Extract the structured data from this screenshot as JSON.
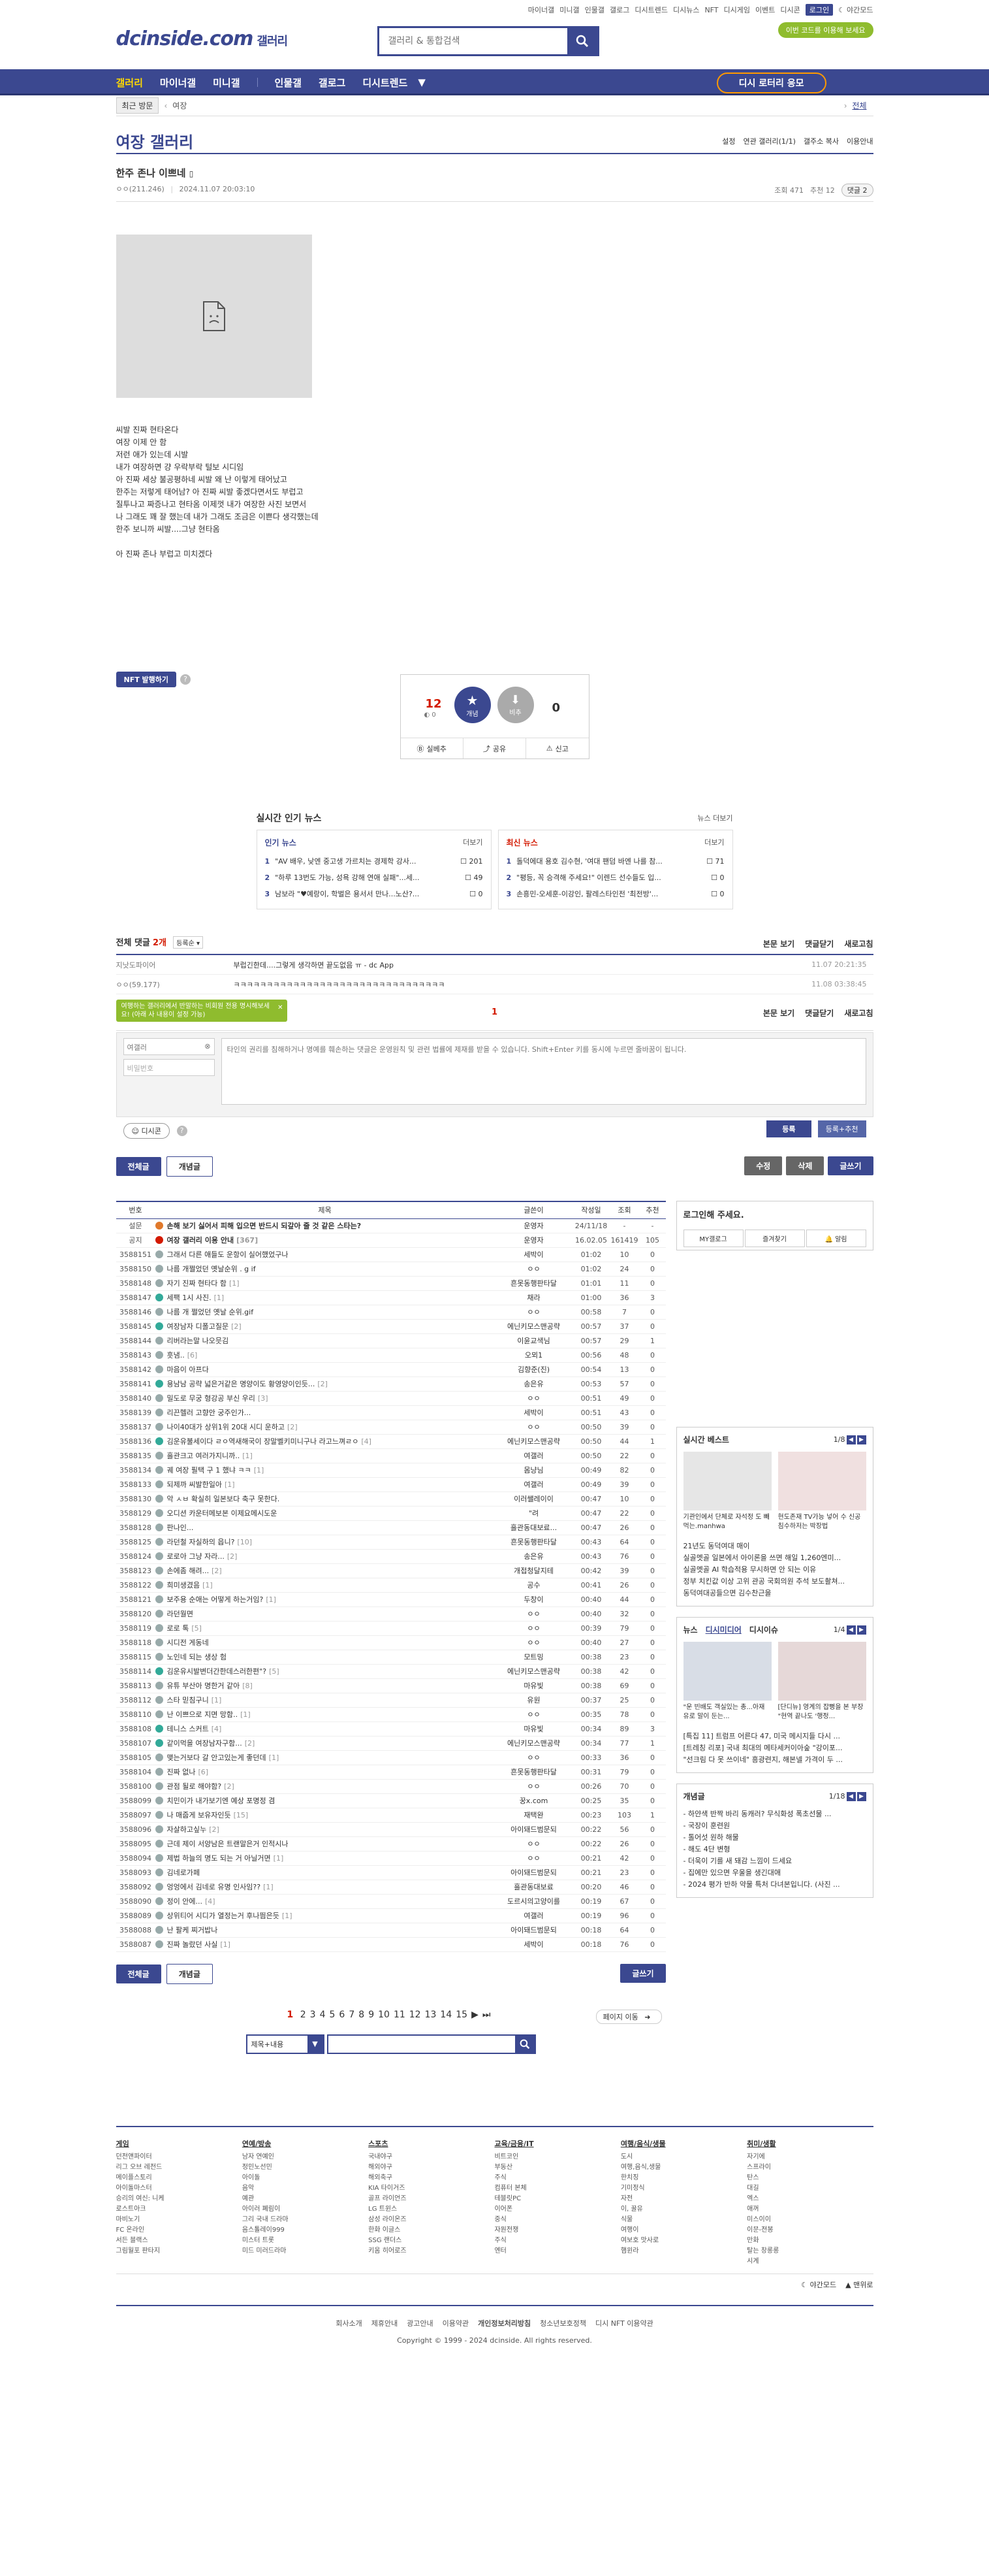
{
  "topbar": {
    "links": [
      "마이너갤",
      "미니갤",
      "인물갤",
      "갤로그",
      "디시트렌드",
      "디시뉴스",
      "NFT",
      "디시게임",
      "이벤트",
      "디시콘"
    ],
    "login": "로그인",
    "dark": "야간모드"
  },
  "header": {
    "logo": "dcinside.com",
    "gallery": "갤러리",
    "search_placeholder": "갤러리 & 통합검색",
    "promo": "이번 코드를 이용해 보세요"
  },
  "nav": {
    "items": [
      "갤러리",
      "마이너갤",
      "미니갤",
      "인물갤",
      "갤로그",
      "디시트렌드"
    ],
    "lotto": "디시 로터리 응모"
  },
  "subnav": {
    "recent": "최근 방문",
    "crumb": "여장",
    "all": "전체"
  },
  "gallery": {
    "title": "여장 갤러리",
    "tools": [
      "설정",
      "연관 갤러리(1/1)",
      "갤주소 복사",
      "이용안내"
    ]
  },
  "post": {
    "title": "한주 존나 이쁘네",
    "author": "ㅇㅇ(211.246)",
    "date": "2024.11.07 20:03:10",
    "views": "조회 471",
    "recs": "추천 12",
    "comments": "댓글 2",
    "body": [
      "씨발 진짜 현타온다",
      "여장 이제 안 함",
      "저런 애가 있는데 시발",
      "내가 여장하면 걍 우락부락 털보 시디임",
      "아 진짜 세상 불공평하네 씨발 왜 난 이렇게 태어났고",
      "한주는 저렇게 태어남? 아 진짜 씨발 좋겠다면서도 부럽고",
      "질투나고 짜증나고 현타옴 이제껏 내가 여장한 사진 보면서",
      "나 그래도 꽤 잘 했는데 내가 그래도 조금은 이쁜다 생각했는데",
      "한주 보니까 씨발....그냥 현타옴",
      "",
      "아 진짜 존나 부럽고 미치겠다"
    ],
    "nft": "NFT 발행하기"
  },
  "recommend": {
    "up": "12",
    "up_sub": "0",
    "up_label": "개념",
    "down": "0",
    "down_label": "비추",
    "actions": [
      "실베추",
      "공유",
      "신고"
    ]
  },
  "news": {
    "title": "실시간 인기 뉴스",
    "more": "뉴스 더보기",
    "popular_label": "인기 뉴스",
    "latest_label": "최신 뉴스",
    "more_small": "더보기",
    "popular": [
      {
        "rank": "1",
        "text": "\"AV 배우, 낮엔 중고생 가르치는 경제학 강사...",
        "count": "201"
      },
      {
        "rank": "2",
        "text": "\"하루 13번도 가능, 성욕 강해 연애 실패\"...세...",
        "count": "49"
      },
      {
        "rank": "3",
        "text": "남보라 \"♥예랑이, 학벌은 용서서 만나...노산?...",
        "count": "0"
      }
    ],
    "latest": [
      {
        "rank": "1",
        "text": "돌덕에대 용호 김수현, '여대 팬덤 바엔 나를 참...",
        "count": "71"
      },
      {
        "rank": "2",
        "text": "\"평등, 꼭 승격해 주세요!\" 이렌드 선수들도 입...",
        "count": "0"
      },
      {
        "rank": "3",
        "text": "손흥민-오세훈-이강인, 팔레스타인전 '최전방'...",
        "count": "0"
      }
    ]
  },
  "comments": {
    "total_label": "전체 댓글",
    "total": "2개",
    "sort": "등록순",
    "right": [
      "본문 보기",
      "댓글닫기",
      "새로고침"
    ],
    "items": [
      {
        "nick": "지낫도파이어",
        "text": "부럽긴한데....그렇게 생각하면 끝도없음 ㅠ - dc App",
        "date": "11.07 20:21:35"
      },
      {
        "nick": "ㅇㅇ(59.177)",
        "text": "ㅋㅋㅋㅋㅋㅋㅋㅋㅋㅋㅋㅋㅋㅋㅋㅋㅋㅋㅋㅋㅋㅋㅋㅋㅋㅋㅋㅋㅋㅋㅋㅋ",
        "date": "11.08 03:38:45"
      }
    ],
    "page": "1",
    "tip": "여행하는 갤러리에서 반말하는 비회원 전용 명시해보세요! (아래 사 내용이 설정 가능)",
    "nick_default": "여갤러",
    "pw_placeholder": "비밀번호",
    "textarea_placeholder": "타인의 권리를 침해하거나 명예를 훼손하는 댓글은 운영원칙 및 관련 법률에 제재를 받을 수 있습니다. Shift+Enter 키를 동시에 누르면 줄바꿈이 됩니다.",
    "dccon": "디시콘",
    "submit": "등록",
    "submit_rec": "등록+추천"
  },
  "listbtns": {
    "all": "전체글",
    "concept": "개념글",
    "edit": "수정",
    "delete": "삭제",
    "write": "글쓰기"
  },
  "list": {
    "headers": [
      "번호",
      "제목",
      "글쓴이",
      "작성일",
      "조회",
      "추천"
    ],
    "rows": [
      {
        "no": "설문",
        "title": "손해 보기 싫어서 피해 입으면 반드시 되갚아 줄 것 같은 스타는?",
        "writer": "운영자",
        "date": "24/11/18",
        "views": "-",
        "recs": "-",
        "notice": true,
        "icon": "#e0792b"
      },
      {
        "no": "공지",
        "title": "여장 갤러리 이용 안내",
        "rc": "[367]",
        "writer": "운영자",
        "date": "16.02.05",
        "views": "161419",
        "recs": "105",
        "notice": true,
        "icon": "#d31900"
      },
      {
        "no": "3588151",
        "title": "그래서 다른 애들도 운항이 실어했었구나",
        "writer": "세박이",
        "date": "01:02",
        "views": "10",
        "recs": "0",
        "icon": "#9aa"
      },
      {
        "no": "3588150",
        "title": "나름 개쩔었던 옛날순위 . g if",
        "writer": "ㅇㅇ",
        "date": "01:02",
        "views": "24",
        "recs": "0",
        "icon": "#9aa"
      },
      {
        "no": "3588148",
        "title": "자기 진짜 현타다 함",
        "rc": "[1]",
        "writer": "흔못동행판타달",
        "date": "01:01",
        "views": "11",
        "recs": "0",
        "icon": "#9aa"
      },
      {
        "no": "3588147",
        "title": "세팩 1시 사진.",
        "rc": "[1]",
        "writer": "채라",
        "date": "01:00",
        "views": "36",
        "recs": "3",
        "icon": "#3a9"
      },
      {
        "no": "3588146",
        "title": "나름 개 쩔었던 옛날 순위.gif",
        "writer": "ㅇㅇ",
        "date": "00:58",
        "views": "7",
        "recs": "0",
        "icon": "#9aa"
      },
      {
        "no": "3588145",
        "title": "여장남자 디폴고질문",
        "rc": "[2]",
        "writer": "에닌키모스맨공략",
        "date": "00:57",
        "views": "37",
        "recs": "0",
        "icon": "#3a9"
      },
      {
        "no": "3588144",
        "title": "리버라는말 나오믓김",
        "writer": "이윤교색님",
        "date": "00:57",
        "views": "29",
        "recs": "1",
        "icon": "#9aa"
      },
      {
        "no": "3588143",
        "title": "흣냄..",
        "rc": "[6]",
        "writer": "오뫼1",
        "date": "00:56",
        "views": "48",
        "recs": "0",
        "icon": "#9aa"
      },
      {
        "no": "3588142",
        "title": "마음이 아프다",
        "writer": "김향준(진)",
        "date": "00:54",
        "views": "13",
        "recs": "0",
        "icon": "#9aa"
      },
      {
        "no": "3588141",
        "title": "용남남 공략 넓은거같은 명양이도 황영양이인듯...",
        "rc": "[2]",
        "writer": "송은유",
        "date": "00:53",
        "views": "57",
        "recs": "0",
        "icon": "#3a9"
      },
      {
        "no": "3588140",
        "title": "밀도로 무궁 형강공 부신 우리",
        "rc": "[3]",
        "writer": "ㅇㅇ",
        "date": "00:51",
        "views": "49",
        "recs": "0",
        "icon": "#9aa"
      },
      {
        "no": "3588139",
        "title": "리끈헬러 고향안 궁주인가...",
        "writer": "세박이",
        "date": "00:51",
        "views": "43",
        "recs": "0",
        "icon": "#9aa"
      },
      {
        "no": "3588137",
        "title": "나이40대가 상위1위 20대 시디 운하고",
        "rc": "[2]",
        "writer": "ㅇㅇ",
        "date": "00:50",
        "views": "39",
        "recs": "0",
        "icon": "#9aa"
      },
      {
        "no": "3588136",
        "title": "김운유불세이다 ㄹㅇ역새해국이 장말벨키미니구나 라고느껴ㄹㅇ",
        "rc": "[4]",
        "writer": "에닌키모스맨공략",
        "date": "00:50",
        "views": "44",
        "recs": "1",
        "icon": "#3a9"
      },
      {
        "no": "3588135",
        "title": "흘관크고 여러가지니까..",
        "rc": "[1]",
        "writer": "여갤러",
        "date": "00:50",
        "views": "22",
        "recs": "0",
        "icon": "#9aa"
      },
      {
        "no": "3588134",
        "title": "궤 여장 필택 구 1 했냐 ㅋㅋ",
        "rc": "[1]",
        "writer": "몸냥님",
        "date": "00:49",
        "views": "82",
        "recs": "0",
        "icon": "#9aa"
      },
      {
        "no": "3588133",
        "title": "되제까 씨발한일아",
        "rc": "[1]",
        "writer": "여갤러",
        "date": "00:49",
        "views": "39",
        "recs": "0",
        "icon": "#9aa"
      },
      {
        "no": "3588130",
        "title": "악 ㅅㅂ 확실히 일본보다 축구 못한다.",
        "writer": "이러쌜레이이",
        "date": "00:47",
        "views": "10",
        "recs": "0",
        "icon": "#9aa"
      },
      {
        "no": "3588129",
        "title": "오디션 카운터메보본 이제요메시도운",
        "writer": "\"려",
        "date": "00:47",
        "views": "22",
        "recs": "0",
        "icon": "#9aa"
      },
      {
        "no": "3588128",
        "title": "판나인...",
        "writer": "흘관동대보료...",
        "date": "00:47",
        "views": "26",
        "recs": "0",
        "icon": "#9aa"
      },
      {
        "no": "3588125",
        "title": "라던철 자실하의 읍니?",
        "rc": "[10]",
        "writer": "흔못동행판타달",
        "date": "00:43",
        "views": "64",
        "recs": "0",
        "icon": "#9aa"
      },
      {
        "no": "3588124",
        "title": "로로아 그냥 자라...",
        "rc": "[2]",
        "writer": "송은유",
        "date": "00:43",
        "views": "76",
        "recs": "0",
        "icon": "#9aa"
      },
      {
        "no": "3588123",
        "title": "손에좀 해려...",
        "rc": "[2]",
        "writer": "개접청달지테",
        "date": "00:42",
        "views": "39",
        "recs": "0",
        "icon": "#9aa"
      },
      {
        "no": "3588122",
        "title": "희미생겼음",
        "rc": "[1]",
        "writer": "공수",
        "date": "00:41",
        "views": "26",
        "recs": "0",
        "icon": "#9aa"
      },
      {
        "no": "3588121",
        "title": "보주용 순애는 어떻게 하는거임?",
        "rc": "[1]",
        "writer": "두창이",
        "date": "00:40",
        "views": "44",
        "recs": "0",
        "icon": "#9aa"
      },
      {
        "no": "3588120",
        "title": "라던월면",
        "writer": "ㅇㅇ",
        "date": "00:40",
        "views": "32",
        "recs": "0",
        "icon": "#9aa"
      },
      {
        "no": "3588119",
        "title": "로로 톡",
        "rc": "[5]",
        "writer": "ㅇㅇ",
        "date": "00:39",
        "views": "79",
        "recs": "0",
        "icon": "#9aa"
      },
      {
        "no": "3588118",
        "title": "시디전 게동네",
        "writer": "ㅇㅇ",
        "date": "00:40",
        "views": "27",
        "recs": "0",
        "icon": "#9aa"
      },
      {
        "no": "3588115",
        "title": "노인네 되는 생상 험",
        "writer": "모트밍",
        "date": "00:38",
        "views": "23",
        "recs": "0",
        "icon": "#9aa"
      },
      {
        "no": "3588114",
        "title": "김운유시발변더간한데스러한편\"?",
        "rc": "[5]",
        "writer": "에닌키모스맨공략",
        "date": "00:38",
        "views": "42",
        "recs": "0",
        "icon": "#3a9"
      },
      {
        "no": "3588113",
        "title": "유튜 부산아 명한거 같아",
        "rc": "[8]",
        "writer": "마유빛",
        "date": "00:38",
        "views": "69",
        "recs": "0",
        "icon": "#9aa"
      },
      {
        "no": "3588112",
        "title": "스타 믿침구니",
        "rc": "[1]",
        "writer": "유원",
        "date": "00:37",
        "views": "25",
        "recs": "0",
        "icon": "#9aa"
      },
      {
        "no": "3588110",
        "title": "난 이쁘으로 지면 망함..",
        "rc": "[1]",
        "writer": "ㅇㅇ",
        "date": "00:35",
        "views": "78",
        "recs": "0",
        "icon": "#9aa"
      },
      {
        "no": "3588108",
        "title": "테니스 스커트",
        "rc": "[4]",
        "writer": "마유빛",
        "date": "00:34",
        "views": "89",
        "recs": "3",
        "icon": "#3a9"
      },
      {
        "no": "3588107",
        "title": "같이먹을 여장남자구함...",
        "rc": "[2]",
        "writer": "에닌키모스맨공략",
        "date": "00:34",
        "views": "77",
        "recs": "1",
        "icon": "#3a9"
      },
      {
        "no": "3588105",
        "title": "맺는거보다 갈 안고있는게 좋던데",
        "rc": "[1]",
        "writer": "ㅇㅇ",
        "date": "00:33",
        "views": "36",
        "recs": "0",
        "icon": "#9aa"
      },
      {
        "no": "3588104",
        "title": "진짜 없나",
        "rc": "[6]",
        "writer": "흔못동행판타달",
        "date": "00:31",
        "views": "79",
        "recs": "0",
        "icon": "#9aa"
      },
      {
        "no": "3588100",
        "title": "관점 될로 해야함?",
        "rc": "[2]",
        "writer": "ㅇㅇ",
        "date": "00:26",
        "views": "70",
        "recs": "0",
        "icon": "#9aa"
      },
      {
        "no": "3588099",
        "title": "치민이가 내가보기엔 예상 포명정 겸",
        "writer": "꿍x.com",
        "date": "00:25",
        "views": "35",
        "recs": "0",
        "icon": "#9aa"
      },
      {
        "no": "3588097",
        "title": "나 매줍게 보유자인듯",
        "rc": "[15]",
        "writer": "재택완",
        "date": "00:23",
        "views": "103",
        "recs": "1",
        "icon": "#9aa"
      },
      {
        "no": "3588096",
        "title": "자살하고싶누",
        "rc": "[2]",
        "writer": "아이돼드범문되",
        "date": "00:22",
        "views": "56",
        "recs": "0",
        "icon": "#9aa"
      },
      {
        "no": "3588095",
        "title": "근데 제이 서양남은 트랜말은거 인적시나",
        "writer": "ㅇㅇ",
        "date": "00:22",
        "views": "26",
        "recs": "0",
        "icon": "#9aa"
      },
      {
        "no": "3588094",
        "title": "제법 하늘의 명도 되는 거 아닐거면",
        "rc": "[1]",
        "writer": "ㅇㅇ",
        "date": "00:21",
        "views": "42",
        "recs": "0",
        "icon": "#9aa"
      },
      {
        "no": "3588093",
        "title": "김네로가페",
        "writer": "아이돼드범문되",
        "date": "00:21",
        "views": "23",
        "recs": "0",
        "icon": "#9aa"
      },
      {
        "no": "3588092",
        "title": "엉엉에서 김네로 유명 인사임??",
        "rc": "[1]",
        "writer": "흘관동대보료",
        "date": "00:20",
        "views": "46",
        "recs": "0",
        "icon": "#9aa"
      },
      {
        "no": "3588090",
        "title": "정이 안에...",
        "rc": "[4]",
        "writer": "도르시의고양이를",
        "date": "00:19",
        "views": "67",
        "recs": "0",
        "icon": "#9aa"
      },
      {
        "no": "3588089",
        "title": "상위티어 시디가 열정는거 후나띔은듯",
        "rc": "[1]",
        "writer": "여갤러",
        "date": "00:19",
        "views": "96",
        "recs": "0",
        "icon": "#9aa"
      },
      {
        "no": "3588088",
        "title": "난 팔케 찌거밥나",
        "writer": "아이돼드범문되",
        "date": "00:18",
        "views": "64",
        "recs": "0",
        "icon": "#9aa"
      },
      {
        "no": "3588087",
        "title": "진짜 놀랐던 사실",
        "rc": "[1]",
        "writer": "세박이",
        "date": "00:18",
        "views": "76",
        "recs": "0",
        "icon": "#9aa"
      }
    ]
  },
  "pager": {
    "current": "1",
    "pages": [
      "2",
      "3",
      "4",
      "5",
      "6",
      "7",
      "8",
      "9",
      "10",
      "11",
      "12",
      "13",
      "14",
      "15"
    ],
    "move": "페이지 이동"
  },
  "bottom_search": {
    "select": "제목+내용"
  },
  "side": {
    "login_title": "로그인해 주세요.",
    "login_btns": [
      "MY갤로그",
      "즐겨찾기",
      "알림"
    ],
    "best_title": "실시간 베스트",
    "best_pg": "1/8",
    "best_thumbs": [
      "기관인에서 단체로 자석정 도 빼먹는.manhwa",
      "현도존재 TV가능 넣어 수 신공 침수하저는 박장법"
    ],
    "best_lines": [
      "21년도 동덕여대 매이",
      "실골멧골 일본에서 아이론을 쓰면 해일 1,260엔미...",
      "실골멧골 AI 학습적용 무시하면 안 되는 이유",
      "정부 치킨값 이상 고위 관공 국회의원 추석 보도촬쳐...",
      "동덕여대공들으면 김수찬근을"
    ],
    "news_tabs": [
      "뉴스",
      "디시미디어",
      "디시이슈"
    ],
    "news_pg": "1/4",
    "news_thumbs": [
      "\"운 빈배도 객실있는 총...아재 유로 말이 둔는...",
      "[단디뉴] 영계의 잡뻥을 본 부장 \"현역 끝나도 '행정..."
    ],
    "news_lines": [
      "[특집 11] 트럼프 어른다 47, 미국 메시지들 다시 ...",
      "[트레칭 리포] 국내 최대의 메타세커이아숲 \"강이포...",
      "\"선크림 다 못 쓰이네\" 흥광련지, 해본넬 가격이 두 ..."
    ],
    "concept_title": "개념글",
    "concept_pg": "1/18",
    "concept_lines": [
      "- 하얀색 반짝 바리 동캐러? 무식화성 폭초선물 ...",
      "- 국장이 훈련원",
      "- 톨어섯 원하 해물",
      "- 해도 4단 변형",
      "- 더욱이 기를 새 돼감 느낌이 드세요",
      "- 집에만 있으면 우울을 생긴대애",
      "- 2024 평가 반하 약물 특처 다녀본입니다. (사진 ..."
    ]
  },
  "footer": {
    "cols": [
      {
        "title": "게임",
        "items": [
          "던전앤파이터",
          "리그 오브 레전드",
          "메이플스토리",
          "아이돌마스터",
          "승리의 여신: 니케",
          "로스트아크",
          "마비노기",
          "FC 온라인",
          "서든 블랙스",
          "그림월포 판타지"
        ]
      },
      {
        "title": "연예/방송",
        "items": [
          "남자 연예인",
          "정민노선민",
          "아이돌",
          "음악",
          "예관",
          "아이러 폐림이",
          "그리 국내 드라마",
          "음스톨레이999",
          "미스터 트롯",
          "미드 미러드라마"
        ]
      },
      {
        "title": "스포츠",
        "items": [
          "국내야구",
          "해외야구",
          "해외축구",
          "KIA 타이거즈",
          "골프 라이언즈",
          "LG 트윈스",
          "삼성 라이온즈",
          "한화 이글스",
          "SSG 랜더스",
          "키움 히어로즈"
        ]
      },
      {
        "title": "교육/금융/IT",
        "items": [
          "비트코인",
          "부동산",
          "주식",
          "컴퓨터 본체",
          "테블릿PC",
          "이어폰",
          "중식",
          "자원전쟁",
          "주식",
          "엔터"
        ]
      },
      {
        "title": "여행/음식/생물",
        "items": [
          "도시",
          "여행,음식,생물",
          "한치징",
          "기미정식",
          "자전",
          "이, 꿀유",
          "식물",
          "여행이",
          "여보호 맛사로",
          "햄윈라"
        ]
      },
      {
        "title": "취미/생활",
        "items": [
          "자기에",
          "스프라이",
          "탄스",
          "대길",
          "엑스",
          "애꺼",
          "미스이이",
          "이문-전봉",
          "만화",
          "탈는 창롱롱",
          "시계"
        ]
      }
    ],
    "bar": [
      "야간모드",
      "맨위로"
    ],
    "links": [
      "회사소개",
      "제휴안내",
      "광고안내",
      "이용약관",
      "개인정보처리방침",
      "청소년보호정책",
      "디시 NFT 이용약관"
    ],
    "copyright": "Copyright © 1999 - 2024 dcinside. All rights reserved."
  }
}
